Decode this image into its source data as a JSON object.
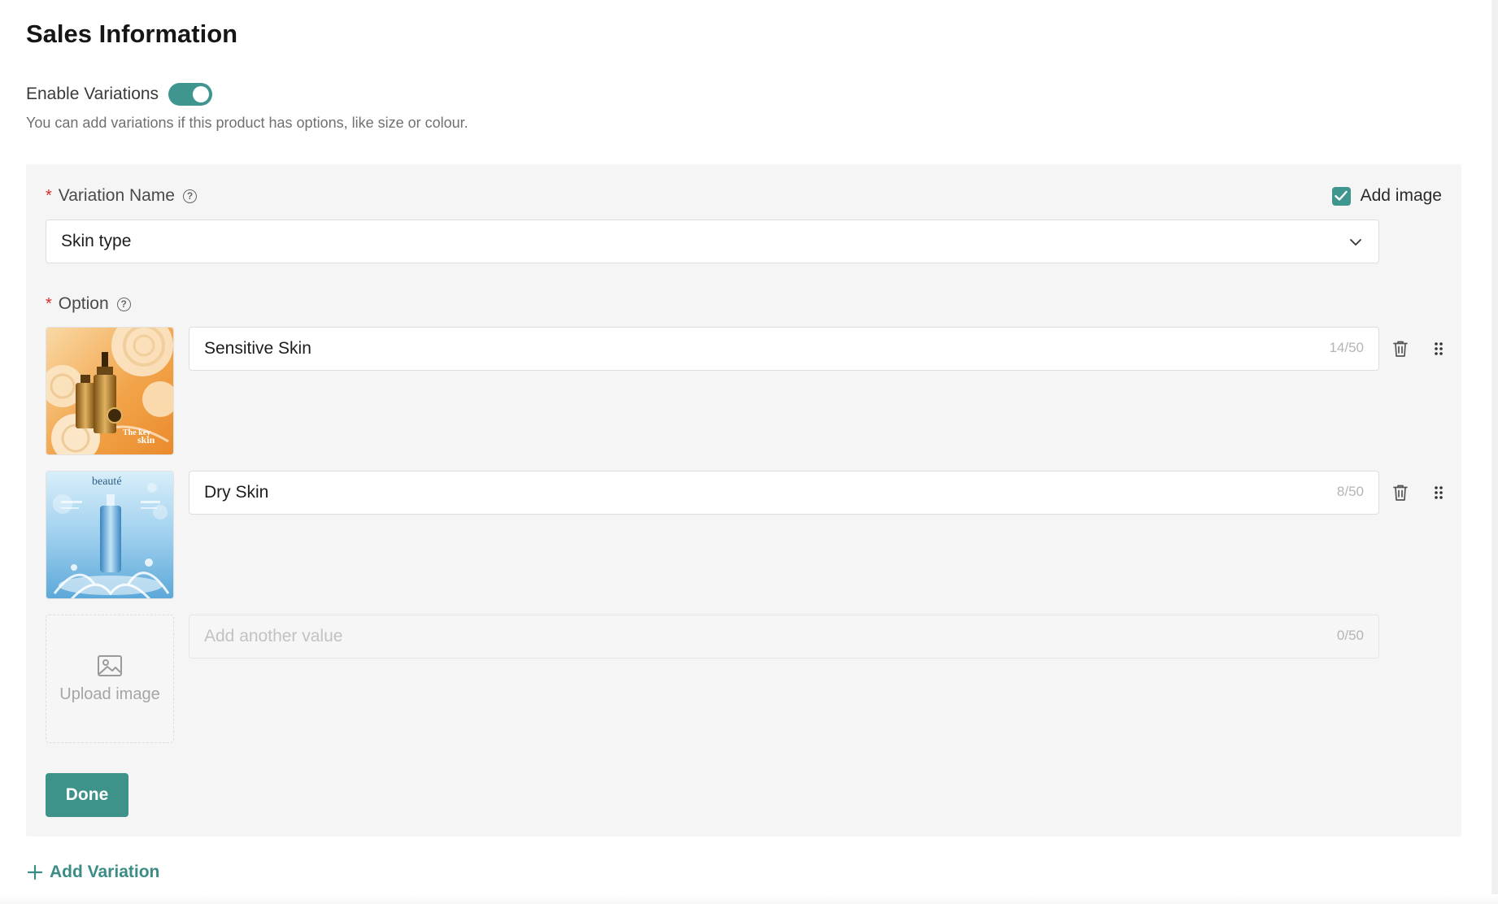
{
  "section": {
    "title": "Sales Information"
  },
  "variations_toggle": {
    "label": "Enable Variations",
    "enabled": true,
    "hint": "You can add variations if this product has options, like size or colour."
  },
  "variation": {
    "name_label": "Variation Name",
    "name_value": "Skin type",
    "add_image_label": "Add image",
    "add_image_checked": true,
    "option_label": "Option",
    "options": [
      {
        "value": "Sensitive Skin",
        "counter": "14/50"
      },
      {
        "value": "Dry Skin",
        "counter": "8/50"
      }
    ],
    "new_option": {
      "placeholder": "Add another value",
      "counter": "0/50",
      "upload_label": "Upload image"
    },
    "done_label": "Done"
  },
  "add_variation_label": "Add Variation",
  "product_images": [
    {
      "caption": "The key to skin"
    },
    {
      "caption": "beauté"
    }
  ],
  "colors": {
    "accent": "#3f968f",
    "required": "#d92b2b"
  }
}
